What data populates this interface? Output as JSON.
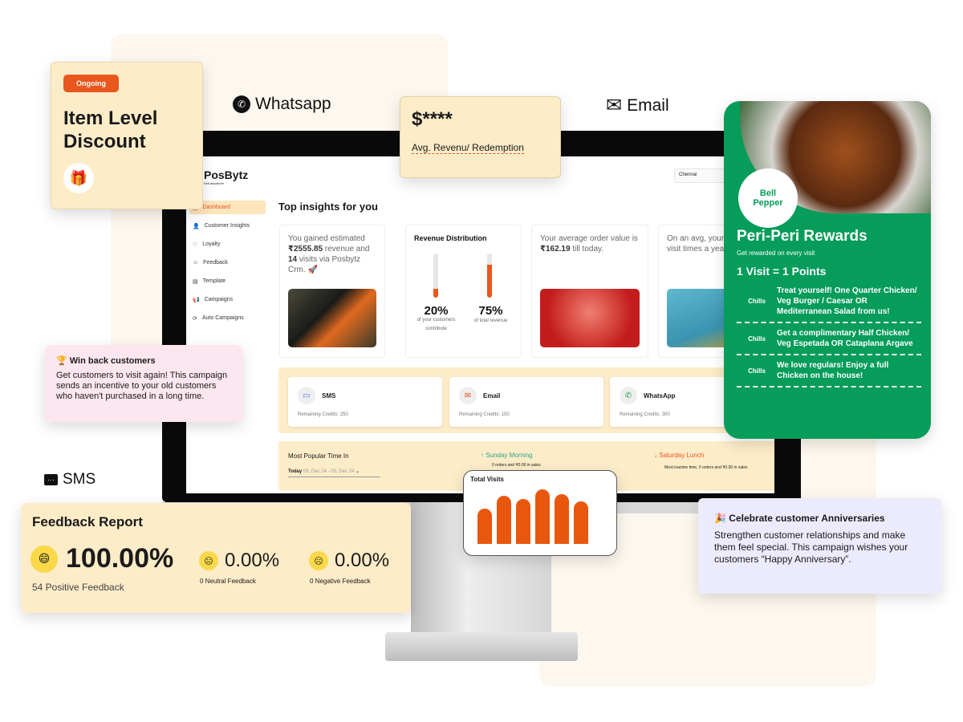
{
  "app": {
    "logo": "PosBytz",
    "tagline": "Sell anywhere",
    "location": "Chennai"
  },
  "sidebar": {
    "items": [
      {
        "label": "Dashboard",
        "icon": "home-icon"
      },
      {
        "label": "Customer Insights",
        "icon": "user-icon"
      },
      {
        "label": "Loyalty",
        "icon": "heart-icon"
      },
      {
        "label": "Feedback",
        "icon": "smile-icon"
      },
      {
        "label": "Template",
        "icon": "template-icon"
      },
      {
        "label": "Campaigns",
        "icon": "megaphone-icon"
      },
      {
        "label": "Auto Campaigns",
        "icon": "refresh-icon"
      }
    ]
  },
  "main": {
    "title": "Top insights for you",
    "insight1": {
      "pre": "You gained estimated",
      "amount": "₹2555.85",
      "mid": "revenue and",
      "visits": "14",
      "post": "visits via Posbytz Crm. 🚀"
    },
    "revenue": {
      "title": "Revenue Distribution",
      "customers_pct": "20%",
      "customers_label": "of your customers contribute",
      "revenue_pct": "75%",
      "revenue_label": "of total revenue",
      "customers_fill": 0.2,
      "revenue_fill": 0.75
    },
    "aov": {
      "pre": "Your average order value is",
      "amount": "₹162.19",
      "post": "till today."
    },
    "visits": {
      "text": "On an avg, your customers visit times a year."
    },
    "credits": [
      {
        "name": "SMS",
        "remaining": "Remaining Credits: 250"
      },
      {
        "name": "Email",
        "remaining": "Remaining Credits: 150"
      },
      {
        "name": "WhatsApp",
        "remaining": "Remaining Credits: 300"
      }
    ],
    "popular": {
      "title": "Most Popular Time In",
      "range_label": "Today",
      "range": "05, Dec 24 - 05, Dec 24",
      "best": "Sunday Morning",
      "best_sub": "0 orders and ₹0.00 in sales",
      "worst": "Saturday Lunch",
      "worst_sub": "Most inactive time, 0 orders and ₹0.00 in sales"
    }
  },
  "floats": {
    "discount": {
      "badge": "Ongoing",
      "title": "Item Level Discount"
    },
    "whatsapp": "Whatsapp",
    "email": "Email",
    "sms": "SMS",
    "redemption": {
      "value": "$****",
      "label": "Avg. Revenu/ Redemption"
    },
    "winback": {
      "title": "🏆 Win back customers",
      "text": "Get customers to visit again! This campaign sends an incentive to your old customers who haven't purchased in a long time."
    },
    "feedback": {
      "title": "Feedback Report",
      "positive": "100.00%",
      "positive_label": "54 Positive Feedback",
      "neutral": "0.00%",
      "neutral_label": "0 Neutral Feedback",
      "negative": "0.00%",
      "negative_label": "0 Negative Feedback"
    },
    "total_visits": {
      "title": "Total Visits",
      "values": [
        0.55,
        0.75,
        0.7,
        0.85,
        0.78,
        0.66
      ]
    },
    "anniversary": {
      "title": "🎉 Celebrate customer Anniversaries",
      "text": "Strengthen customer relationships and make them feel special. This campaign wishes your customers “Happy Anniversary”."
    },
    "rewards": {
      "brand": "Bell Pepper",
      "title": "Peri-Peri Rewards",
      "subtitle": "Get rewarded on every visit",
      "rule": "1 Visit = 1 Points",
      "items": [
        {
          "tag": "Chills",
          "text": "Treat yourself! One Quarter Chicken/ Veg Burger / Caesar OR Mediterranean Salad from us!"
        },
        {
          "tag": "Chills",
          "text": "Get a complimentary Half Chicken/ Veg Espetada OR Cataplana Argave"
        },
        {
          "tag": "Chills",
          "text": "We love regulars! Enjoy a full Chicken on the house!"
        }
      ]
    }
  },
  "colors": {
    "accent": "#e8571e",
    "green": "#069c5a",
    "cream": "#fdecc8",
    "pink": "#fce6ef",
    "lavender": "#ecebfd"
  }
}
